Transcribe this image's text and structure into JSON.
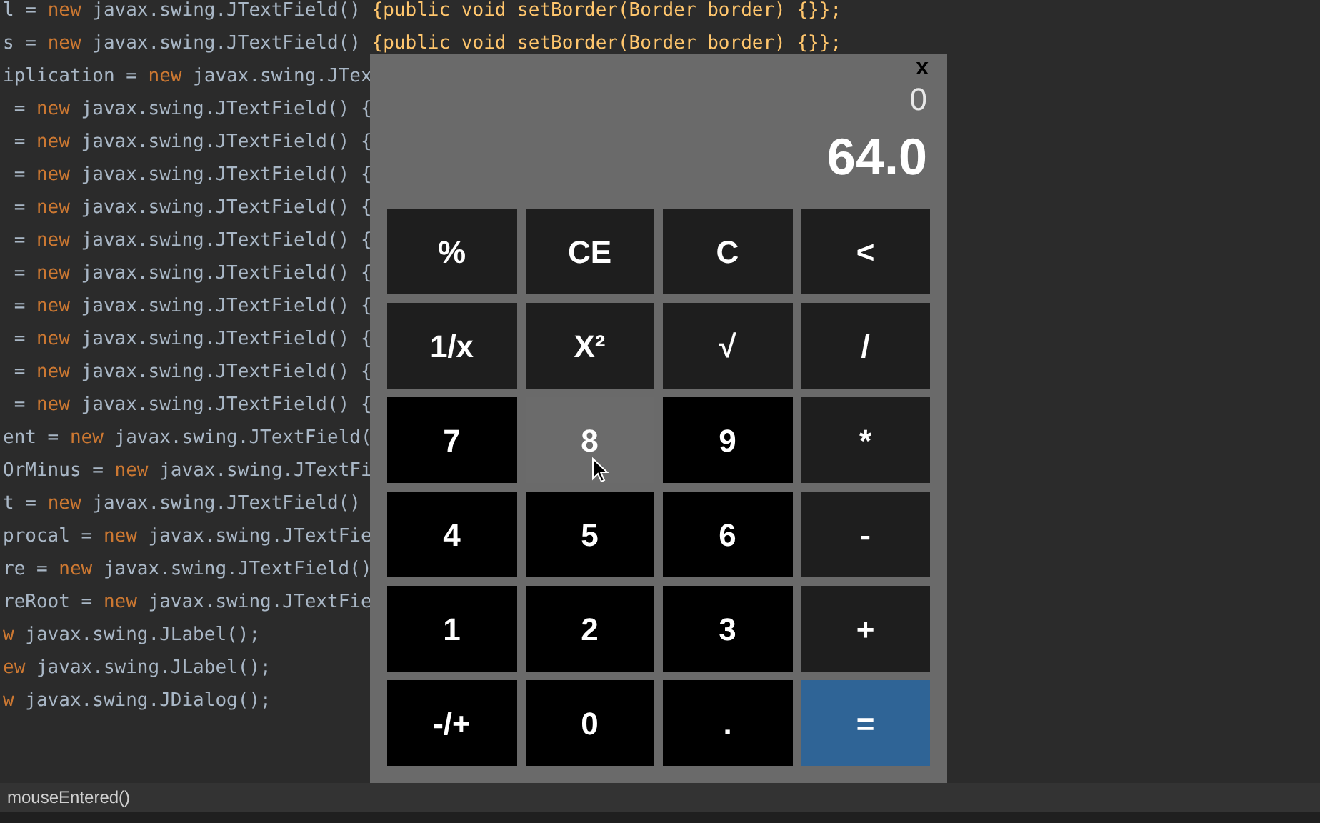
{
  "editor": {
    "lines": [
      {
        "parts": [
          {
            "kind": "plain",
            "text": "l = "
          },
          {
            "kind": "keyword",
            "text": "new"
          },
          {
            "kind": "plain",
            "text": " javax.swing.JTextField() "
          },
          {
            "kind": "method",
            "text": "{public void setBorder(Border border) {}};"
          }
        ]
      },
      {
        "parts": [
          {
            "kind": "plain",
            "text": "s = "
          },
          {
            "kind": "keyword",
            "text": "new"
          },
          {
            "kind": "plain",
            "text": " javax.swing.JTextField() "
          },
          {
            "kind": "method",
            "text": "{public void setBorder(Border border) {}};"
          }
        ]
      },
      {
        "parts": [
          {
            "kind": "plain",
            "text": "iplication = "
          },
          {
            "kind": "keyword",
            "text": "new"
          },
          {
            "kind": "plain",
            "text": " javax.swing.JTex"
          }
        ]
      },
      {
        "parts": [
          {
            "kind": "plain",
            "text": " = "
          },
          {
            "kind": "keyword",
            "text": "new"
          },
          {
            "kind": "plain",
            "text": " javax.swing.JTextField() {"
          }
        ]
      },
      {
        "parts": [
          {
            "kind": "plain",
            "text": " = "
          },
          {
            "kind": "keyword",
            "text": "new"
          },
          {
            "kind": "plain",
            "text": " javax.swing.JTextField() {"
          }
        ]
      },
      {
        "parts": [
          {
            "kind": "plain",
            "text": " = "
          },
          {
            "kind": "keyword",
            "text": "new"
          },
          {
            "kind": "plain",
            "text": " javax.swing.JTextField() {"
          }
        ]
      },
      {
        "parts": [
          {
            "kind": "plain",
            "text": " = "
          },
          {
            "kind": "keyword",
            "text": "new"
          },
          {
            "kind": "plain",
            "text": " javax.swing.JTextField() {"
          }
        ]
      },
      {
        "parts": [
          {
            "kind": "plain",
            "text": " = "
          },
          {
            "kind": "keyword",
            "text": "new"
          },
          {
            "kind": "plain",
            "text": " javax.swing.JTextField() {"
          }
        ]
      },
      {
        "parts": [
          {
            "kind": "plain",
            "text": " = "
          },
          {
            "kind": "keyword",
            "text": "new"
          },
          {
            "kind": "plain",
            "text": " javax.swing.JTextField() {"
          }
        ]
      },
      {
        "parts": [
          {
            "kind": "plain",
            "text": " = "
          },
          {
            "kind": "keyword",
            "text": "new"
          },
          {
            "kind": "plain",
            "text": " javax.swing.JTextField() {"
          }
        ]
      },
      {
        "parts": [
          {
            "kind": "plain",
            "text": " = "
          },
          {
            "kind": "keyword",
            "text": "new"
          },
          {
            "kind": "plain",
            "text": " javax.swing.JTextField() {"
          }
        ]
      },
      {
        "parts": [
          {
            "kind": "plain",
            "text": " = "
          },
          {
            "kind": "keyword",
            "text": "new"
          },
          {
            "kind": "plain",
            "text": " javax.swing.JTextField() {"
          }
        ]
      },
      {
        "parts": [
          {
            "kind": "plain",
            "text": " = "
          },
          {
            "kind": "keyword",
            "text": "new"
          },
          {
            "kind": "plain",
            "text": " javax.swing.JTextField() {"
          }
        ]
      },
      {
        "parts": [
          {
            "kind": "plain",
            "text": "ent = "
          },
          {
            "kind": "keyword",
            "text": "new"
          },
          {
            "kind": "plain",
            "text": " javax.swing.JTextField("
          }
        ]
      },
      {
        "parts": [
          {
            "kind": "plain",
            "text": "OrMinus = "
          },
          {
            "kind": "keyword",
            "text": "new"
          },
          {
            "kind": "plain",
            "text": " javax.swing.JTextFi"
          }
        ]
      },
      {
        "parts": [
          {
            "kind": "plain",
            "text": "t = "
          },
          {
            "kind": "keyword",
            "text": "new"
          },
          {
            "kind": "plain",
            "text": " javax.swing.JTextField()"
          }
        ]
      },
      {
        "parts": [
          {
            "kind": "plain",
            "text": "procal = "
          },
          {
            "kind": "keyword",
            "text": "new"
          },
          {
            "kind": "plain",
            "text": " javax.swing.JTextFie"
          }
        ]
      },
      {
        "parts": [
          {
            "kind": "plain",
            "text": "re = "
          },
          {
            "kind": "keyword",
            "text": "new"
          },
          {
            "kind": "plain",
            "text": " javax.swing.JTextField()"
          }
        ]
      },
      {
        "parts": [
          {
            "kind": "plain",
            "text": "reRoot = "
          },
          {
            "kind": "keyword",
            "text": "new"
          },
          {
            "kind": "plain",
            "text": " javax.swing.JTextFie"
          }
        ]
      },
      {
        "parts": [
          {
            "kind": "keyword",
            "text": "w"
          },
          {
            "kind": "plain",
            "text": " javax.swing.JLabel();"
          }
        ]
      },
      {
        "parts": [
          {
            "kind": "keyword",
            "text": "ew"
          },
          {
            "kind": "plain",
            "text": " javax.swing.JLabel();"
          }
        ]
      },
      {
        "parts": [
          {
            "kind": "keyword",
            "text": "w"
          },
          {
            "kind": "plain",
            "text": " javax.swing.JDialog();"
          }
        ]
      }
    ]
  },
  "calculator": {
    "close": "x",
    "expression": "0",
    "result": "64.0",
    "buttons": [
      {
        "label": "%",
        "kind": "function",
        "hovered": false
      },
      {
        "label": "CE",
        "kind": "function",
        "hovered": false
      },
      {
        "label": "C",
        "kind": "function",
        "hovered": false
      },
      {
        "label": "<",
        "kind": "function",
        "hovered": false
      },
      {
        "label": "1/x",
        "kind": "function",
        "hovered": false
      },
      {
        "label": "X²",
        "kind": "function",
        "hovered": false
      },
      {
        "label": "√",
        "kind": "function",
        "hovered": false
      },
      {
        "label": "/",
        "kind": "function",
        "hovered": false
      },
      {
        "label": "7",
        "kind": "digit",
        "hovered": false
      },
      {
        "label": "8",
        "kind": "digit",
        "hovered": true
      },
      {
        "label": "9",
        "kind": "digit",
        "hovered": false
      },
      {
        "label": "*",
        "kind": "function",
        "hovered": false
      },
      {
        "label": "4",
        "kind": "digit",
        "hovered": false
      },
      {
        "label": "5",
        "kind": "digit",
        "hovered": false
      },
      {
        "label": "6",
        "kind": "digit",
        "hovered": false
      },
      {
        "label": "-",
        "kind": "function",
        "hovered": false
      },
      {
        "label": "1",
        "kind": "digit",
        "hovered": false
      },
      {
        "label": "2",
        "kind": "digit",
        "hovered": false
      },
      {
        "label": "3",
        "kind": "digit",
        "hovered": false
      },
      {
        "label": "+",
        "kind": "function",
        "hovered": false
      },
      {
        "label": "-/+",
        "kind": "digit",
        "hovered": false
      },
      {
        "label": "0",
        "kind": "digit",
        "hovered": false
      },
      {
        "label": ".",
        "kind": "digit",
        "hovered": false
      },
      {
        "label": "=",
        "kind": "equals",
        "hovered": false
      }
    ]
  },
  "status_bar": {
    "text": "mouseEntered()"
  }
}
